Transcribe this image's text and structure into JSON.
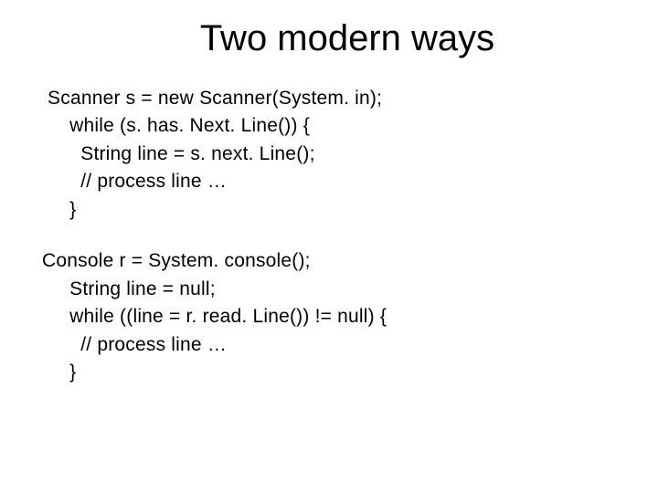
{
  "title": "Two modern ways",
  "code1": {
    "l1": " Scanner s = new Scanner(System. in);",
    "l2": "     while (s. has. Next. Line()) {",
    "l3": "       String line = s. next. Line();",
    "l4": "       // process line …",
    "l5": "     }"
  },
  "code2": {
    "l1": "Console r = System. console();",
    "l2": "     String line = null;",
    "l3": "     while ((line = r. read. Line()) != null) {",
    "l4": "       // process line …",
    "l5": "     }"
  }
}
